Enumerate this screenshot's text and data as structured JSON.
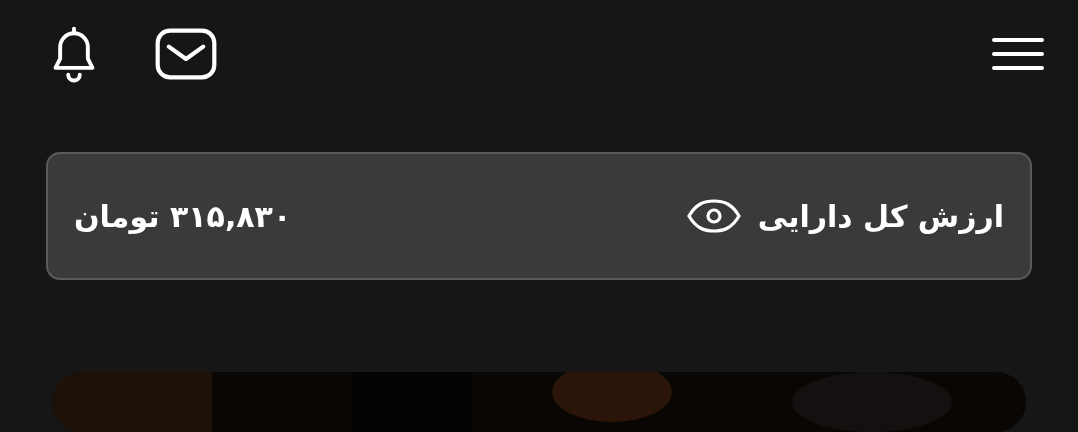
{
  "balance_card": {
    "label": "ارزش کل دارایی",
    "amount": "۳۱۵,۸۳۰ تومان",
    "visible": true
  }
}
